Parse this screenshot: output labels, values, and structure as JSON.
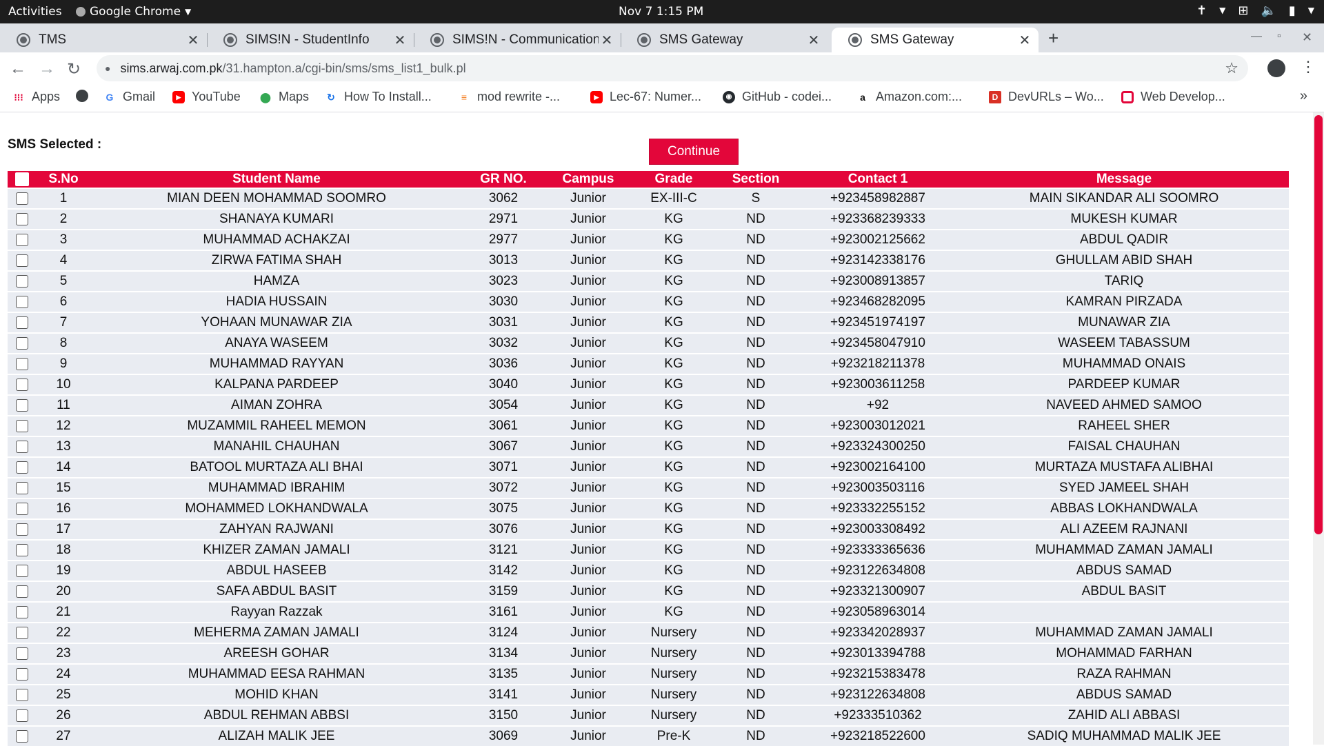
{
  "os": {
    "activities": "Activities",
    "app_name": "Google Chrome",
    "clock": "Nov 7  1:15 PM"
  },
  "tabs": [
    {
      "label": "TMS",
      "active": false
    },
    {
      "label": "SIMS!N - StudentInfo",
      "active": false
    },
    {
      "label": "SIMS!N - Communication",
      "active": false
    },
    {
      "label": "SMS Gateway",
      "active": false
    },
    {
      "label": "SMS Gateway",
      "active": true
    }
  ],
  "address": {
    "host": "sims.arwaj.com.pk",
    "path": "/31.hampton.a/cgi-bin/sms/sms_list1_bulk.pl"
  },
  "bookmarks": [
    {
      "label": "Apps",
      "icon": "apps-grid-icon"
    },
    {
      "label": "",
      "icon": "globe-icon"
    },
    {
      "label": "Gmail",
      "icon": "google-icon"
    },
    {
      "label": "YouTube",
      "icon": "youtube-icon"
    },
    {
      "label": "Maps",
      "icon": "maps-pin-icon"
    },
    {
      "label": "How To Install...",
      "icon": "refresh-logo-icon"
    },
    {
      "label": "mod rewrite -...",
      "icon": "stackoverflow-icon"
    },
    {
      "label": "Lec-67: Numer...",
      "icon": "youtube-icon"
    },
    {
      "label": "GitHub - codei...",
      "icon": "github-icon"
    },
    {
      "label": "Amazon.com:...",
      "icon": "amazon-icon"
    },
    {
      "label": "DevURLs – Wo...",
      "icon": "devurls-icon"
    },
    {
      "label": "Web Develop...",
      "icon": "bookmark-red-icon"
    }
  ],
  "page": {
    "sms_selected_label": "SMS Selected :",
    "continue_label": "Continue",
    "accent": "#e3063a"
  },
  "table": {
    "headers": [
      "S.No",
      "Student Name",
      "GR NO.",
      "Campus",
      "Grade",
      "Section",
      "Contact 1",
      "Message"
    ],
    "rows": [
      [
        "1",
        "MIAN DEEN MOHAMMAD SOOMRO",
        "3062",
        "Junior",
        "EX-III-C",
        "S",
        "+923458982887",
        "MAIN SIKANDAR ALI SOOMRO"
      ],
      [
        "2",
        "SHANAYA KUMARI",
        "2971",
        "Junior",
        "KG",
        "ND",
        "+923368239333",
        "MUKESH KUMAR"
      ],
      [
        "3",
        "MUHAMMAD ACHAKZAI",
        "2977",
        "Junior",
        "KG",
        "ND",
        "+923002125662",
        "ABDUL QADIR"
      ],
      [
        "4",
        "ZIRWA FATIMA SHAH",
        "3013",
        "Junior",
        "KG",
        "ND",
        "+923142338176",
        "GHULLAM ABID SHAH"
      ],
      [
        "5",
        "HAMZA",
        "3023",
        "Junior",
        "KG",
        "ND",
        "+923008913857",
        "TARIQ"
      ],
      [
        "6",
        "HADIA HUSSAIN",
        "3030",
        "Junior",
        "KG",
        "ND",
        "+923468282095",
        "KAMRAN PIRZADA"
      ],
      [
        "7",
        "YOHAAN MUNAWAR ZIA",
        "3031",
        "Junior",
        "KG",
        "ND",
        "+923451974197",
        "MUNAWAR ZIA"
      ],
      [
        "8",
        "ANAYA WASEEM",
        "3032",
        "Junior",
        "KG",
        "ND",
        "+923458047910",
        "WASEEM TABASSUM"
      ],
      [
        "9",
        "MUHAMMAD RAYYAN",
        "3036",
        "Junior",
        "KG",
        "ND",
        "+923218211378",
        "MUHAMMAD ONAIS"
      ],
      [
        "10",
        "KALPANA PARDEEP",
        "3040",
        "Junior",
        "KG",
        "ND",
        "+923003611258",
        "PARDEEP KUMAR"
      ],
      [
        "11",
        "AIMAN ZOHRA",
        "3054",
        "Junior",
        "KG",
        "ND",
        "+92",
        "NAVEED AHMED SAMOO"
      ],
      [
        "12",
        "MUZAMMIL RAHEEL MEMON",
        "3061",
        "Junior",
        "KG",
        "ND",
        "+923003012021",
        "RAHEEL SHER"
      ],
      [
        "13",
        "MANAHIL CHAUHAN",
        "3067",
        "Junior",
        "KG",
        "ND",
        "+923324300250",
        "FAISAL CHAUHAN"
      ],
      [
        "14",
        "BATOOL MURTAZA ALI BHAI",
        "3071",
        "Junior",
        "KG",
        "ND",
        "+923002164100",
        "MURTAZA MUSTAFA ALIBHAI"
      ],
      [
        "15",
        "MUHAMMAD IBRAHIM",
        "3072",
        "Junior",
        "KG",
        "ND",
        "+923003503116",
        "SYED JAMEEL SHAH"
      ],
      [
        "16",
        "MOHAMMED LOKHANDWALA",
        "3075",
        "Junior",
        "KG",
        "ND",
        "+923332255152",
        "ABBAS LOKHANDWALA"
      ],
      [
        "17",
        "ZAHYAN RAJWANI",
        "3076",
        "Junior",
        "KG",
        "ND",
        "+923003308492",
        "ALI AZEEM RAJNANI"
      ],
      [
        "18",
        "KHIZER ZAMAN JAMALI",
        "3121",
        "Junior",
        "KG",
        "ND",
        "+923333365636",
        "MUHAMMAD ZAMAN JAMALI"
      ],
      [
        "19",
        "ABDUL HASEEB",
        "3142",
        "Junior",
        "KG",
        "ND",
        "+923122634808",
        "ABDUS SAMAD"
      ],
      [
        "20",
        "SAFA ABDUL BASIT",
        "3159",
        "Junior",
        "KG",
        "ND",
        "+923321300907",
        "ABDUL BASIT"
      ],
      [
        "21",
        "Rayyan Razzak",
        "3161",
        "Junior",
        "KG",
        "ND",
        "+923058963014",
        ""
      ],
      [
        "22",
        "MEHERMA ZAMAN JAMALI",
        "3124",
        "Junior",
        "Nursery",
        "ND",
        "+923342028937",
        "MUHAMMAD ZAMAN JAMALI"
      ],
      [
        "23",
        "AREESH GOHAR",
        "3134",
        "Junior",
        "Nursery",
        "ND",
        "+923013394788",
        "MOHAMMAD FARHAN"
      ],
      [
        "24",
        "MUHAMMAD EESA RAHMAN",
        "3135",
        "Junior",
        "Nursery",
        "ND",
        "+923215383478",
        "RAZA RAHMAN"
      ],
      [
        "25",
        "MOHID KHAN",
        "3141",
        "Junior",
        "Nursery",
        "ND",
        "+923122634808",
        "ABDUS SAMAD"
      ],
      [
        "26",
        "ABDUL REHMAN ABBSI",
        "3150",
        "Junior",
        "Nursery",
        "ND",
        "+92333510362",
        "ZAHID ALI ABBASI"
      ],
      [
        "27",
        "ALIZAH MALIK JEE",
        "3069",
        "Junior",
        "Pre-K",
        "ND",
        "+923218522600",
        "SADIQ MUHAMMAD MALIK JEE"
      ]
    ]
  }
}
